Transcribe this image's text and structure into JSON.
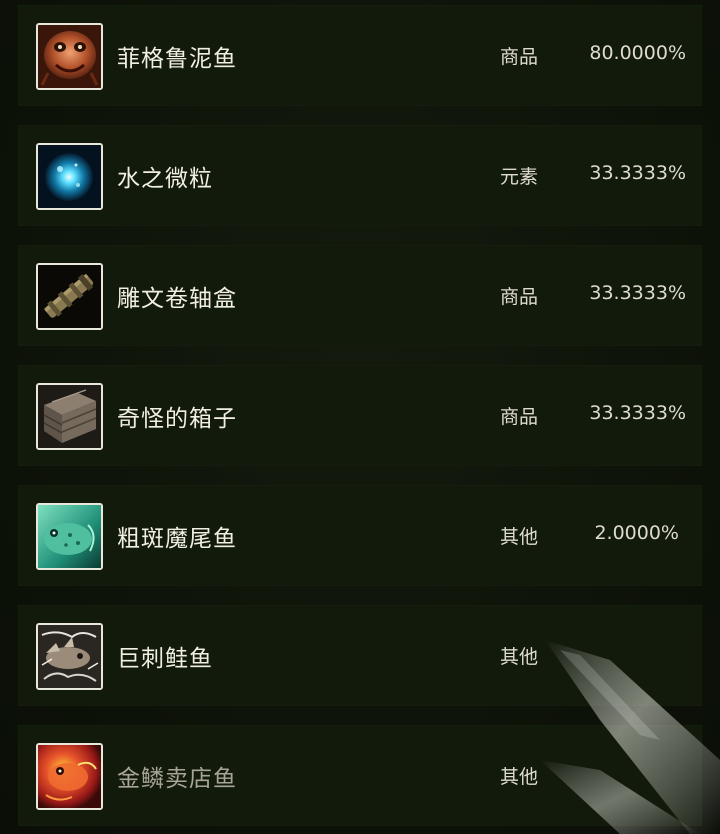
{
  "items": [
    {
      "name": "菲格鲁泥鱼",
      "category": "商品",
      "rate": "80.0000%",
      "icon": "mudfish-icon"
    },
    {
      "name": "水之微粒",
      "category": "元素",
      "rate": "33.3333%",
      "icon": "water-mote-icon"
    },
    {
      "name": "雕文卷轴盒",
      "category": "商品",
      "rate": "33.3333%",
      "icon": "scroll-case-icon"
    },
    {
      "name": "奇怪的箱子",
      "category": "商品",
      "rate": "33.3333%",
      "icon": "crate-icon"
    },
    {
      "name": "粗斑魔尾鱼",
      "category": "其他",
      "rate": "2.0000%",
      "icon": "spotted-fish-icon"
    },
    {
      "name": "巨刺鲑鱼",
      "category": "其他",
      "rate": "",
      "icon": "spined-salmon-icon"
    },
    {
      "name": "金鳞卖店鱼",
      "category": "其他",
      "rate": "",
      "icon": "goldscale-fish-icon"
    }
  ],
  "colors": {
    "background": "#0e1309",
    "row_background": "#121a0c",
    "text": "#f1eee6",
    "icon_border": "#e9e6dc"
  }
}
